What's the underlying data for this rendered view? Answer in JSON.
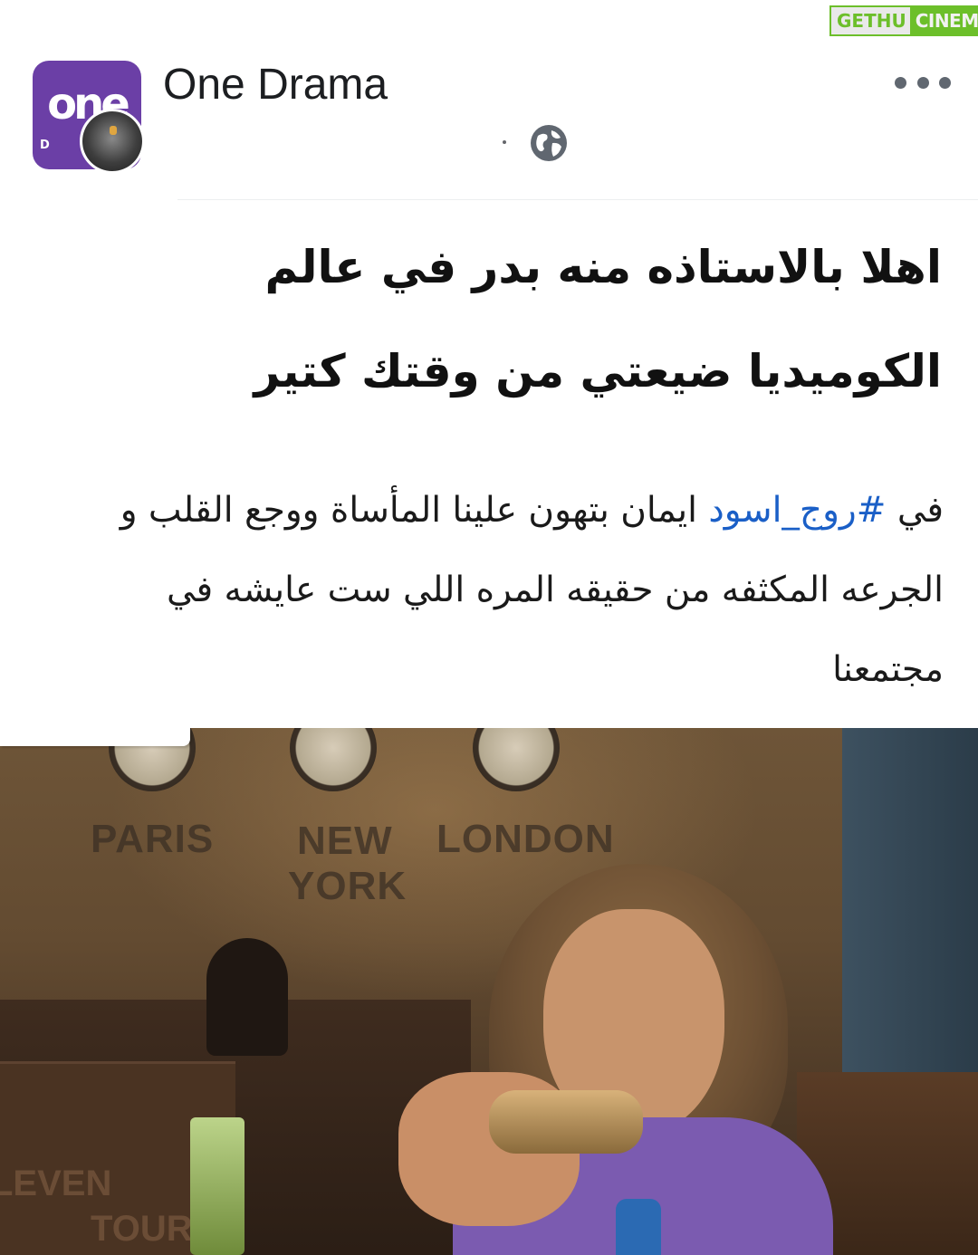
{
  "watermark": {
    "part1": "GETHU",
    "part2": "CINEMA"
  },
  "post": {
    "page_name": "One Drama",
    "avatar_logo": "one",
    "avatar_sub": "D",
    "headline_lines": [
      "اهلا بالاستاذه منه بدر في عالم",
      "الكوميديا ضيعتي من وقتك كتير"
    ],
    "body": {
      "prefix": "في ",
      "hashtag": "#روج_اسود",
      "rest": " ايمان بتهون علينا المأساة ووجع القلب و الجرعه المكثفه من حقيقه المره اللي ست عايشه في مجتمعنا"
    }
  },
  "photo": {
    "cities": [
      "PARIS",
      "NEW",
      "YORK",
      "LONDON"
    ],
    "box_text": [
      "LEVEN",
      "TOUR"
    ]
  },
  "colors": {
    "hashtag": "#1a5fc7",
    "avatar_bg": "#6b3fa6",
    "watermark_green": "#6cbf2a"
  },
  "icons": [
    "globe-icon",
    "more-options-icon"
  ]
}
